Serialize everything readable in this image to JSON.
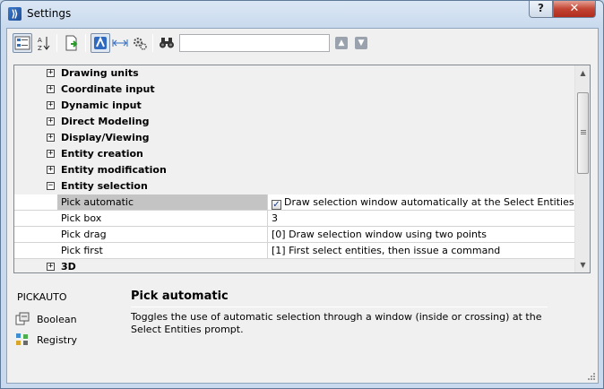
{
  "window": {
    "title": "Settings",
    "help_label": "?",
    "close_label": "✕"
  },
  "toolbar": {
    "search_value": "",
    "icons": [
      "categorized-view-icon",
      "alphabetical-sort-icon",
      "export-icon",
      "drawing-settings-icon",
      "dimension-settings-icon",
      "options-icon",
      "find-icon",
      "search-up-icon",
      "search-down-icon"
    ]
  },
  "tree": {
    "categories_top": [
      {
        "label": "Drawing units",
        "expander": "+"
      },
      {
        "label": "Coordinate input",
        "expander": "+"
      },
      {
        "label": "Dynamic input",
        "expander": "+"
      },
      {
        "label": "Direct Modeling",
        "expander": "+"
      },
      {
        "label": "Display/Viewing",
        "expander": "+"
      },
      {
        "label": "Entity creation",
        "expander": "+"
      },
      {
        "label": "Entity modification",
        "expander": "+"
      },
      {
        "label": "Entity selection",
        "expander": "−"
      }
    ],
    "properties": [
      {
        "name": "Pick automatic",
        "value": "Draw selection window automatically at the Select Entities prompt",
        "checked": true,
        "selected": true
      },
      {
        "name": "Pick box",
        "value": "3"
      },
      {
        "name": "Pick drag",
        "value": "[0] Draw selection window using two points"
      },
      {
        "name": "Pick first",
        "value": "[1] First select entities, then issue a command"
      }
    ],
    "categories_bottom": [
      {
        "label": "3D",
        "expander": "+"
      }
    ]
  },
  "info": {
    "command": "PICKAUTO",
    "type_label": "Boolean",
    "storage_label": "Registry",
    "title": "Pick automatic",
    "description": "Toggles the use of automatic selection through a window (inside or crossing) at the Select Entities prompt."
  },
  "colors": {
    "title_bar": "#c9daee",
    "selected_row": "#c4c4c4",
    "close_button": "#c24432"
  }
}
